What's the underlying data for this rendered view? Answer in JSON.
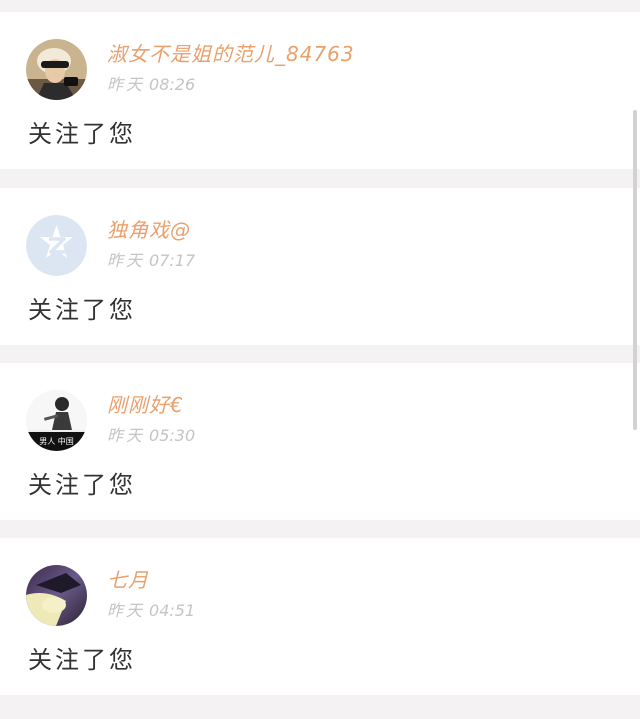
{
  "notifications": [
    {
      "username": "淑女不是姐的范儿_84763",
      "date_label": "昨天",
      "time": "08:26",
      "message": "关注了您",
      "avatar_icon": "avatar-sunglasses-photo"
    },
    {
      "username": "独角戏@",
      "date_label": "昨天",
      "time": "07:17",
      "message": "关注了您",
      "avatar_icon": "default-z-avatar-icon"
    },
    {
      "username": "刚刚好€",
      "date_label": "昨天",
      "time": "05:30",
      "message": "关注了您",
      "avatar_icon": "avatar-man-photo",
      "avatar_caption": "男人 中国"
    },
    {
      "username": "七月",
      "date_label": "昨天",
      "time": "04:51",
      "message": "关注了您",
      "avatar_icon": "avatar-anime-photo"
    }
  ],
  "colors": {
    "username": "#e9a06c",
    "timestamp": "#c4c4c4",
    "message": "#333333",
    "background": "#f4f2f3",
    "default_avatar": "#dbe6f2"
  }
}
